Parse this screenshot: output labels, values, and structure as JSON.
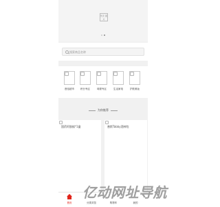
{
  "banner": {
    "placeholder_text": "暂无\n图片"
  },
  "search": {
    "placeholder": "搜索商品名称"
  },
  "categories": [
    {
      "label": "首佰超市"
    },
    {
      "label": "积分专区"
    },
    {
      "label": "母婴专区"
    },
    {
      "label": "生活家电"
    },
    {
      "label": "护肤美妆"
    }
  ],
  "recommend": {
    "title": "为你推荐"
  },
  "products": [
    {
      "name": "国药阿胶糕*1盒"
    },
    {
      "name": "普斯Tabby酒神包"
    }
  ],
  "tabbar": [
    {
      "label": "首页",
      "icon": "home-icon",
      "active": true
    },
    {
      "label": "分类浏览",
      "icon": "grid-icon",
      "active": false
    },
    {
      "label": "购物车",
      "icon": "cart-icon",
      "active": false
    },
    {
      "label": "我的",
      "icon": "user-icon",
      "active": false
    }
  ],
  "watermark": {
    "text": "亿动网址导航"
  },
  "colors": {
    "accent": "#e1251b",
    "background": "#f1f1f1"
  }
}
